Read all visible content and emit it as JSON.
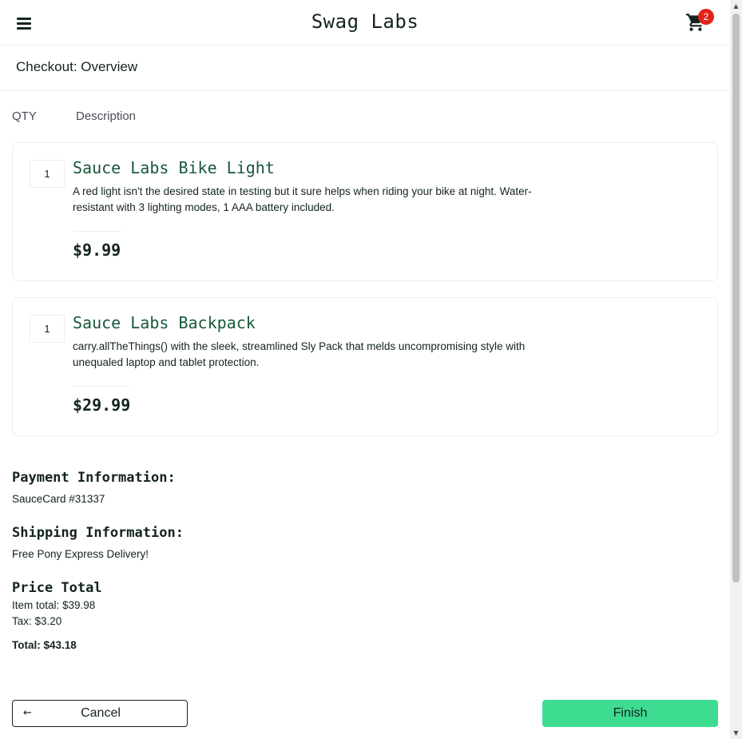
{
  "header": {
    "logo": "Swag Labs",
    "cart_count": "2"
  },
  "sub_header": {
    "title": "Checkout: Overview"
  },
  "columns": {
    "qty": "QTY",
    "description": "Description"
  },
  "items": [
    {
      "qty": "1",
      "name": "Sauce Labs Bike Light",
      "description": "A red light isn't the desired state in testing but it sure helps when riding your bike at night. Water-resistant with 3 lighting modes, 1 AAA battery included.",
      "price": "$9.99"
    },
    {
      "qty": "1",
      "name": "Sauce Labs Backpack",
      "description": "carry.allTheThings() with the sleek, streamlined Sly Pack that melds uncompromising style with unequaled laptop and tablet protection.",
      "price": "$29.99"
    }
  ],
  "summary": {
    "payment_label": "Payment Information:",
    "payment_value": "SauceCard #31337",
    "shipping_label": "Shipping Information:",
    "shipping_value": "Free Pony Express Delivery!",
    "price_label": "Price Total",
    "item_total": "Item total: $39.98",
    "tax": "Tax: $3.20",
    "total": "Total: $43.18"
  },
  "buttons": {
    "cancel": "Cancel",
    "finish": "Finish"
  },
  "icons": {
    "menu": "hamburger-icon",
    "cart": "shopping-cart-icon",
    "back": "arrow-left-icon"
  },
  "colors": {
    "item_name": "#18583a",
    "badge": "#e2231a",
    "finish_button": "#3ddc91"
  }
}
